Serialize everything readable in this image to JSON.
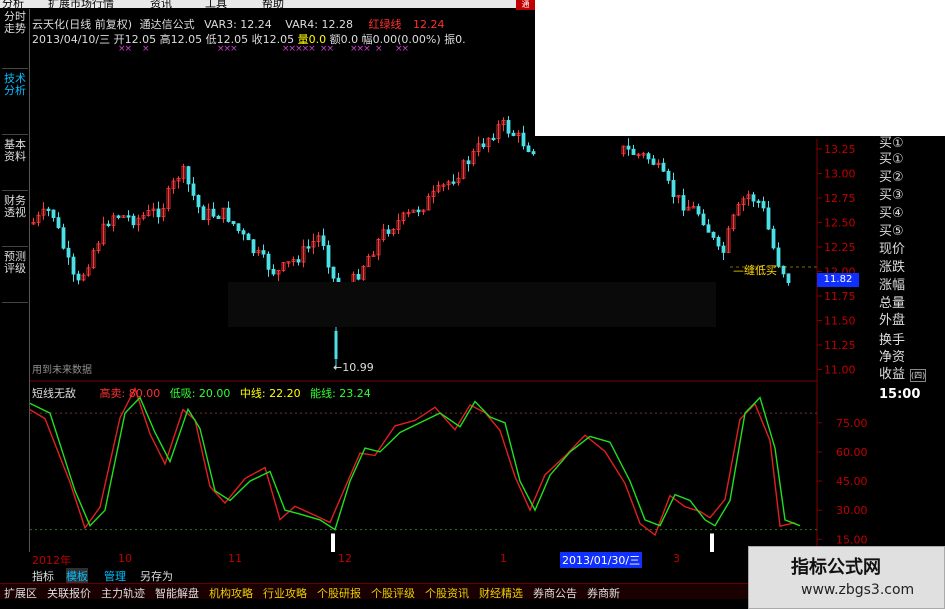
{
  "menu": {
    "items": [
      "分析",
      "扩展市场行情",
      "资讯",
      "工具",
      "帮助"
    ],
    "close_label": "通"
  },
  "left_tabs": [
    {
      "label": "分时走势",
      "active": false
    },
    {
      "label": "技术分析",
      "active": true
    },
    {
      "label": "基本资料",
      "active": false
    },
    {
      "label": "财务透视",
      "active": false
    },
    {
      "label": "预测评级",
      "active": false
    }
  ],
  "header": {
    "line1": [
      {
        "text": "云天化(日线 前复权)",
        "color": "#dddddd"
      },
      {
        "text": "通达信公式",
        "color": "#dddddd"
      },
      {
        "text": "VAR3: 12.24",
        "color": "#dddddd"
      },
      {
        "text": "VAR4: 12.28",
        "color": "#dddddd"
      },
      {
        "text": "红绿线",
        "color": "#ff3030"
      },
      {
        "text": "12.24",
        "color": "#ff3030"
      }
    ],
    "line2": [
      {
        "text": "2013/04/10/三",
        "color": "#dddddd"
      },
      {
        "text": "开12.05",
        "color": "#dddddd"
      },
      {
        "text": "高12.05",
        "color": "#dddddd"
      },
      {
        "text": "低12.05",
        "color": "#dddddd"
      },
      {
        "text": "收12.05",
        "color": "#dddddd"
      },
      {
        "text": "量0.0",
        "color": "#ffff00"
      },
      {
        "text": "额0.0",
        "color": "#dddddd"
      },
      {
        "text": "幅0.00(0.00%)",
        "color": "#dddddd"
      },
      {
        "text": "振0.",
        "color": "#dddddd"
      }
    ]
  },
  "main_chart": {
    "price_labels": [
      "13.25",
      "13.00",
      "12.75",
      "12.50",
      "12.25",
      "12.00",
      "11.75",
      "11.50",
      "11.25",
      "11.00"
    ],
    "current_price": "11.82",
    "low_marker": "10.99",
    "annot_text": "缝低买",
    "watermark_text": "用到未来数据",
    "up_color": "#ff3a3a",
    "down_color": "#4ce0e6"
  },
  "right_panel": {
    "items": [
      "买①",
      "买①",
      "买②",
      "买③",
      "买④",
      "买⑤",
      "现价",
      "涨跌",
      "涨幅",
      "总量",
      "外盘",
      "换手",
      "净资",
      "收益"
    ],
    "badge": "(四)",
    "time": "15:00"
  },
  "indicator": {
    "name": "短线无敌",
    "values": [
      {
        "text": "高卖: 80.00",
        "color": "#ff3030"
      },
      {
        "text": "低吸: 20.00",
        "color": "#30ff30"
      },
      {
        "text": "中线: 22.20",
        "color": "#ffff00"
      },
      {
        "text": "能线: 23.24",
        "color": "#30ff30"
      }
    ],
    "axis_labels": [
      "75.00",
      "60.00",
      "45.00",
      "30.00",
      "15.00"
    ]
  },
  "time_axis": {
    "labels": [
      "2012年",
      "10",
      "11",
      "12",
      "1",
      "3"
    ],
    "selected_date": "2013/01/30/三"
  },
  "bottom_tabs": [
    {
      "label": "指标",
      "active": false
    },
    {
      "label": "模板",
      "active": true
    },
    {
      "label": "管理",
      "active": false
    },
    {
      "label": "另存为",
      "active": false
    }
  ],
  "toolbar": [
    {
      "label": "扩展区",
      "color": "#dddddd"
    },
    {
      "label": "关联报价",
      "color": "#dddddd"
    },
    {
      "label": "主力轨迹",
      "color": "#dddddd"
    },
    {
      "label": "智能解盘",
      "color": "#dddddd"
    },
    {
      "label": "机构攻略",
      "color": "#e8d000"
    },
    {
      "label": "行业攻略",
      "color": "#e8d000"
    },
    {
      "label": "个股研报",
      "color": "#e8d000"
    },
    {
      "label": "个股评级",
      "color": "#e8d000"
    },
    {
      "label": "个股资讯",
      "color": "#e8d000"
    },
    {
      "label": "财经精选",
      "color": "#e8d000"
    },
    {
      "label": "券商公告",
      "color": "#dddddd"
    },
    {
      "label": "券商新",
      "color": "#dddddd"
    }
  ],
  "watermark": {
    "title": "指标公式网",
    "url": "www.zbgs3.com"
  }
}
